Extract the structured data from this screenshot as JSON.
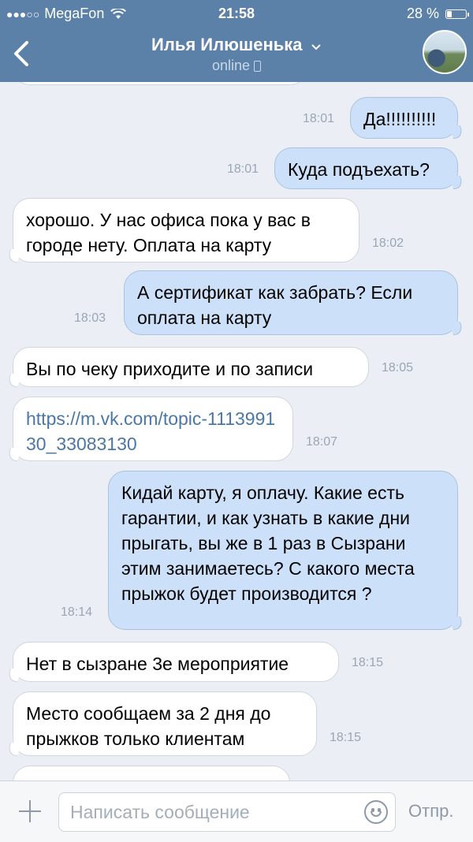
{
  "status_bar": {
    "signal_dots": "●●●○○",
    "carrier": "MegaFon",
    "time": "21:58",
    "battery_text": "28 %",
    "battery_level": 0.28
  },
  "header": {
    "title": "Илья Илюшенька",
    "subtitle": "online",
    "colors": {
      "bar": "#5b81a8"
    }
  },
  "messages": [
    {
      "dir": "out",
      "text": "Да!!!!!!!!!!",
      "time": "18:01"
    },
    {
      "dir": "out",
      "text": "Куда подъехать?",
      "time": "18:01"
    },
    {
      "dir": "in",
      "text": "хорошо. У нас офиса пока у вас в городе нету. Оплата на карту",
      "time": "18:02"
    },
    {
      "dir": "out",
      "text": "А сертификат как забрать? Если оплата на карту",
      "time": "18:03"
    },
    {
      "dir": "in",
      "text": "Вы по чеку приходите и по записи",
      "time": "18:05"
    },
    {
      "dir": "in",
      "text": "https://m.vk.com/topic-111399130_33083130",
      "time": "18:07",
      "link": true
    },
    {
      "dir": "out",
      "text": "Кидай карту, я оплачу. Какие есть гарантии, и как узнать в какие дни прыгать, вы же в 1 раз в Сызрани этим занимаетесь? С какого места прыжок будет производится ?",
      "time": "18:14"
    },
    {
      "dir": "in",
      "text": "Нет в сызране 3е мероприятие",
      "time": "18:15"
    },
    {
      "dir": "in",
      "text": "Место сообщаем за 2 дня до прыжков только клиентам",
      "time": "18:15"
    }
  ],
  "composer": {
    "placeholder": "Написать сообщение",
    "send_label": "Отпр."
  }
}
